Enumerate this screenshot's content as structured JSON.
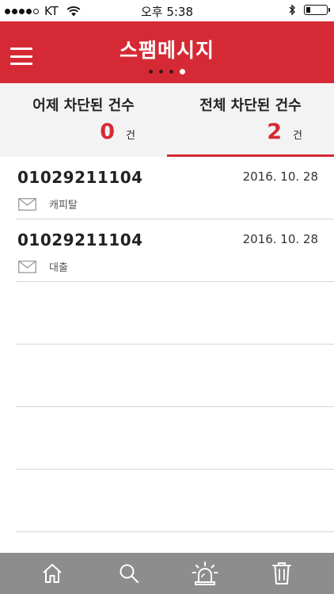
{
  "status_bar": {
    "carrier": "KT",
    "time": "오후 5:38"
  },
  "header": {
    "title": "스팸메시지",
    "page_count": 4,
    "active_page": 4
  },
  "summary": {
    "yesterday": {
      "label": "어제 차단된 건수",
      "count": "0",
      "unit": "건"
    },
    "total": {
      "label": "전체 차단된 건수",
      "count": "2",
      "unit": "건"
    },
    "active_tab": "total"
  },
  "messages": [
    {
      "phone": "01029211104",
      "date": "2016. 10. 28",
      "preview": "캐피탈",
      "icon": "envelope-icon"
    },
    {
      "phone": "01029211104",
      "date": "2016. 10. 28",
      "preview": "대출",
      "icon": "envelope-icon"
    }
  ],
  "bottom_nav": [
    {
      "name": "home",
      "icon": "home-icon"
    },
    {
      "name": "search",
      "icon": "search-icon"
    },
    {
      "name": "alarm",
      "icon": "siren-icon"
    },
    {
      "name": "delete",
      "icon": "trash-icon"
    }
  ],
  "colors": {
    "accent": "#d52a35",
    "bottom_bar": "#8d8d8d",
    "summary_bg": "#f3f3f3"
  }
}
